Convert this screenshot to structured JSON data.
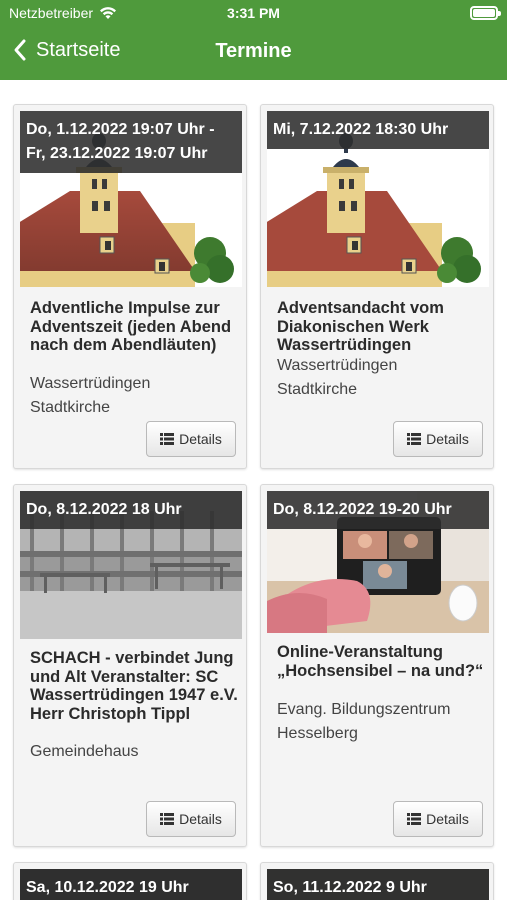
{
  "status_bar": {
    "carrier": "Netzbetreiber",
    "time": "3:31 PM"
  },
  "nav": {
    "back_label": "Startseite",
    "title": "Termine"
  },
  "colors": {
    "brand_green": "#4f9a3c",
    "date_overlay": "#2d2d2d"
  },
  "events": [
    {
      "date": "Do, 1.12.2022 19:07 Uhr - Fr, 23.12.2022 19:07 Uhr",
      "title": "Adventliche Impulse zur Adventszeit (jeden Abend nach dem Abendläuten)",
      "place": "Wassertrüdingen",
      "venue": "Stadtkirche",
      "button": "Details",
      "image": "church-tower"
    },
    {
      "date": "Mi, 7.12.2022 18:30 Uhr",
      "title": "Adventsandacht vom Diakonischen Werk Wassertrüdingen",
      "place": "Wassertrüdingen",
      "venue": "Stadtkirche",
      "button": "Details",
      "image": "church-tower"
    },
    {
      "date": "Do, 8.12.2022 18 Uhr",
      "title": "SCHACH - verbindet Jung und Alt Veranstalter: SC Wassertrüdingen 1947 e.V. Herr Christoph Tippl",
      "place": "Gemeindehaus",
      "venue": "",
      "button": "Details",
      "image": "hall-interior"
    },
    {
      "date": "Do, 8.12.2022 19-20 Uhr",
      "title": "Online-Veranstaltung „Hochsensibel – na und?“",
      "place": "Evang. Bildungszentrum",
      "venue": "Hesselberg",
      "button": "Details",
      "image": "video-call"
    },
    {
      "date": "Sa, 10.12.2022 19 Uhr",
      "title": "",
      "place": "",
      "venue": "",
      "button": "",
      "image": ""
    },
    {
      "date": "So, 11.12.2022 9 Uhr",
      "title": "",
      "place": "",
      "venue": "",
      "button": "",
      "image": ""
    }
  ]
}
